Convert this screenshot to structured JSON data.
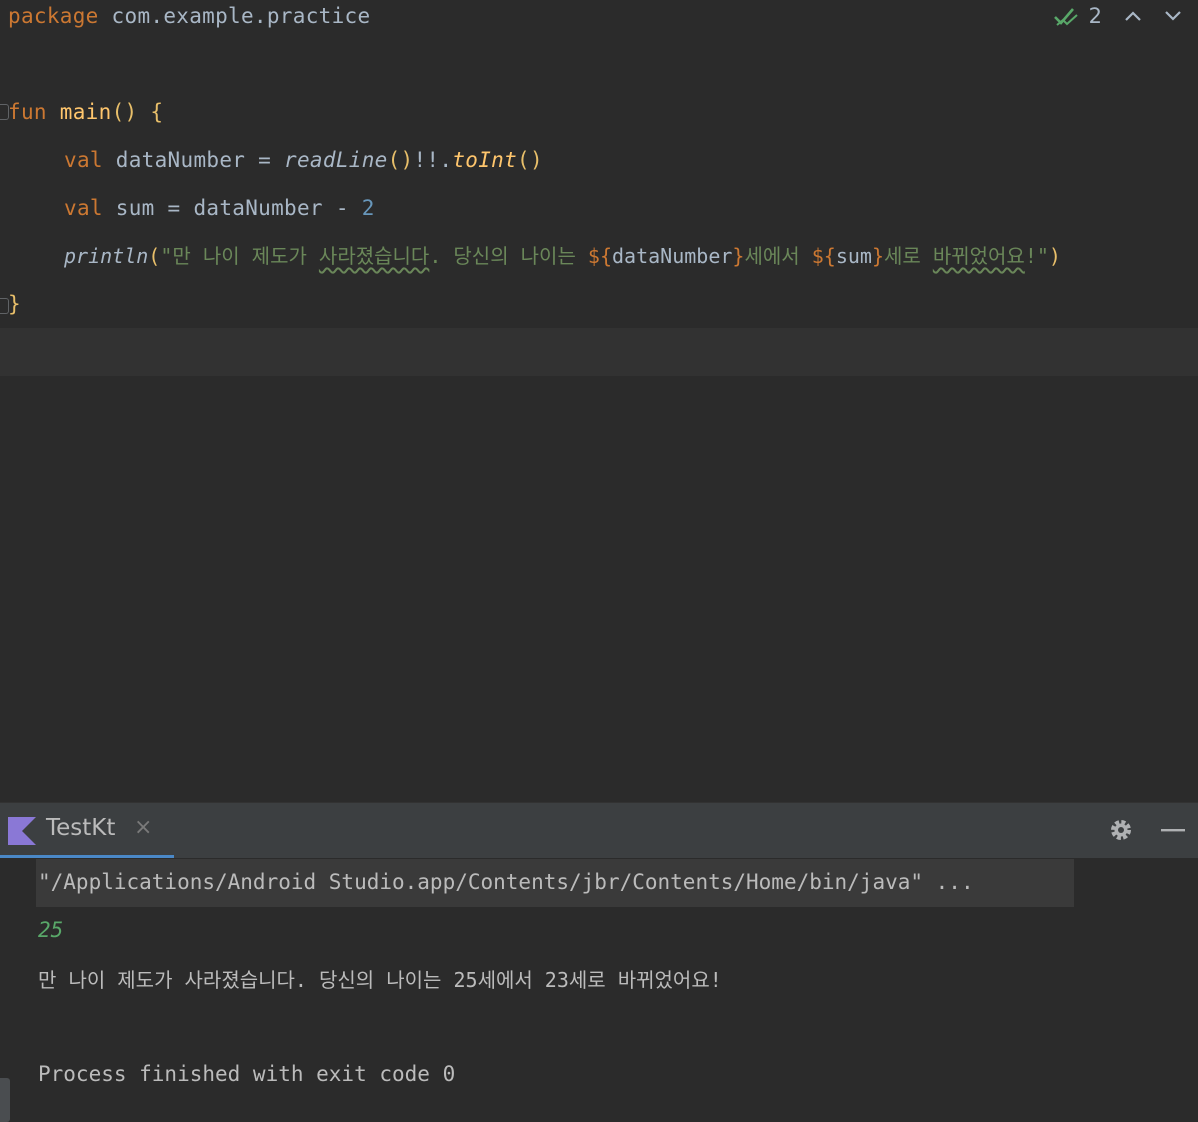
{
  "editor": {
    "inspection_count": "2",
    "line1": {
      "kw": "package",
      "rest": " com.example.practice"
    },
    "line3": {
      "kw": "fun",
      "name": "main",
      "parens": "()",
      "brace": "{"
    },
    "line4": {
      "kw": "val",
      "var": " dataNumber = ",
      "call": "readLine",
      "paren1": "()",
      "bang": "!!.",
      "call2": "toInt",
      "paren2": "()"
    },
    "line5": {
      "kw": "val",
      "mid": " sum = dataNumber - ",
      "num": "2"
    },
    "line6": {
      "call": "println",
      "open": "(",
      "s1": "\"만 나이 제도가 ",
      "s1w": "사라졌습니다",
      "s2": ". 당신의 나이는 ",
      "t1open": "${",
      "t1var": "dataNumber",
      "t1close": "}",
      "s3": "세에서 ",
      "t2open": "${",
      "t2var": "sum",
      "t2close": "}",
      "s4": "세로 ",
      "s4w": "바뀌었어요",
      "s5": "!\"",
      "close": ")"
    },
    "line7": {
      "brace": "}"
    }
  },
  "run_panel": {
    "tab_label": "TestKt",
    "tab_close": "×",
    "output": {
      "command": "\"/Applications/Android Studio.app/Contents/jbr/Contents/Home/bin/java\" ...",
      "input": "25",
      "result": "만 나이 제도가 사라졌습니다. 당신의 나이는 25세에서 23세로 바뀌었어요!",
      "finished": "Process finished with exit code 0"
    }
  },
  "colors": {
    "keyword": "#cc7832",
    "function": "#ffc66d",
    "string": "#6a8759",
    "number": "#6897bb",
    "input_text": "#59a869",
    "accent_tab": "#4a88c7"
  },
  "icons": [
    "check-double-icon",
    "chevron-up-icon",
    "chevron-down-icon",
    "kotlin-icon",
    "gear-icon",
    "minimize-icon"
  ]
}
